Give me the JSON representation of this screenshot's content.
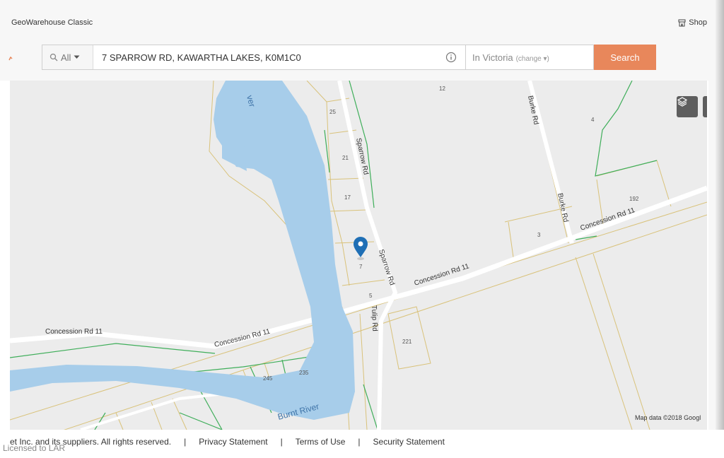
{
  "header": {
    "app_title": "GeoWarehouse Classic",
    "shop_label": "Shop",
    "shop_icon": "store-icon"
  },
  "search": {
    "filter_label": "All",
    "query": "7 SPARROW RD, KAWARTHA LAKES, K0M1C0",
    "location": "In Victoria",
    "change_label": "(change ▾)",
    "button_label": "Search"
  },
  "map": {
    "water_labels": {
      "top": "ver",
      "bottom": "Burnt River"
    },
    "road_labels": {
      "sparrow_north": "Sparrow Rd",
      "sparrow_south": "Sparrow Rd",
      "burke_north": "Burke Rd",
      "burke_south": "Burke Rd",
      "concession_east": "Concession Rd 11",
      "concession_mid": "Concession Rd 11",
      "concession_west1": "Concession Rd 11",
      "concession_west2": "Concession Rd 11",
      "tulip": "Tulip Rd"
    },
    "parcel_numbers": {
      "p12": "12",
      "p25": "25",
      "p21": "21",
      "p17": "17",
      "p7": "7",
      "p5": "5",
      "p4": "4",
      "p192": "192",
      "p3": "3",
      "p221": "221",
      "p245": "245",
      "p235": "235"
    },
    "attribution": "Map data ©2018 Googl",
    "colors": {
      "water": "#a7cdea",
      "land": "#ececec",
      "parcel": "#d9c27a",
      "boundary": "#3fae5a",
      "marker": "#1f6fb5"
    }
  },
  "footer": {
    "copyright": "et Inc. and its suppliers. All rights reserved.",
    "privacy": "Privacy Statement",
    "terms": "Terms of Use",
    "security": "Security Statement",
    "licensed": "Licensed to LAR"
  }
}
